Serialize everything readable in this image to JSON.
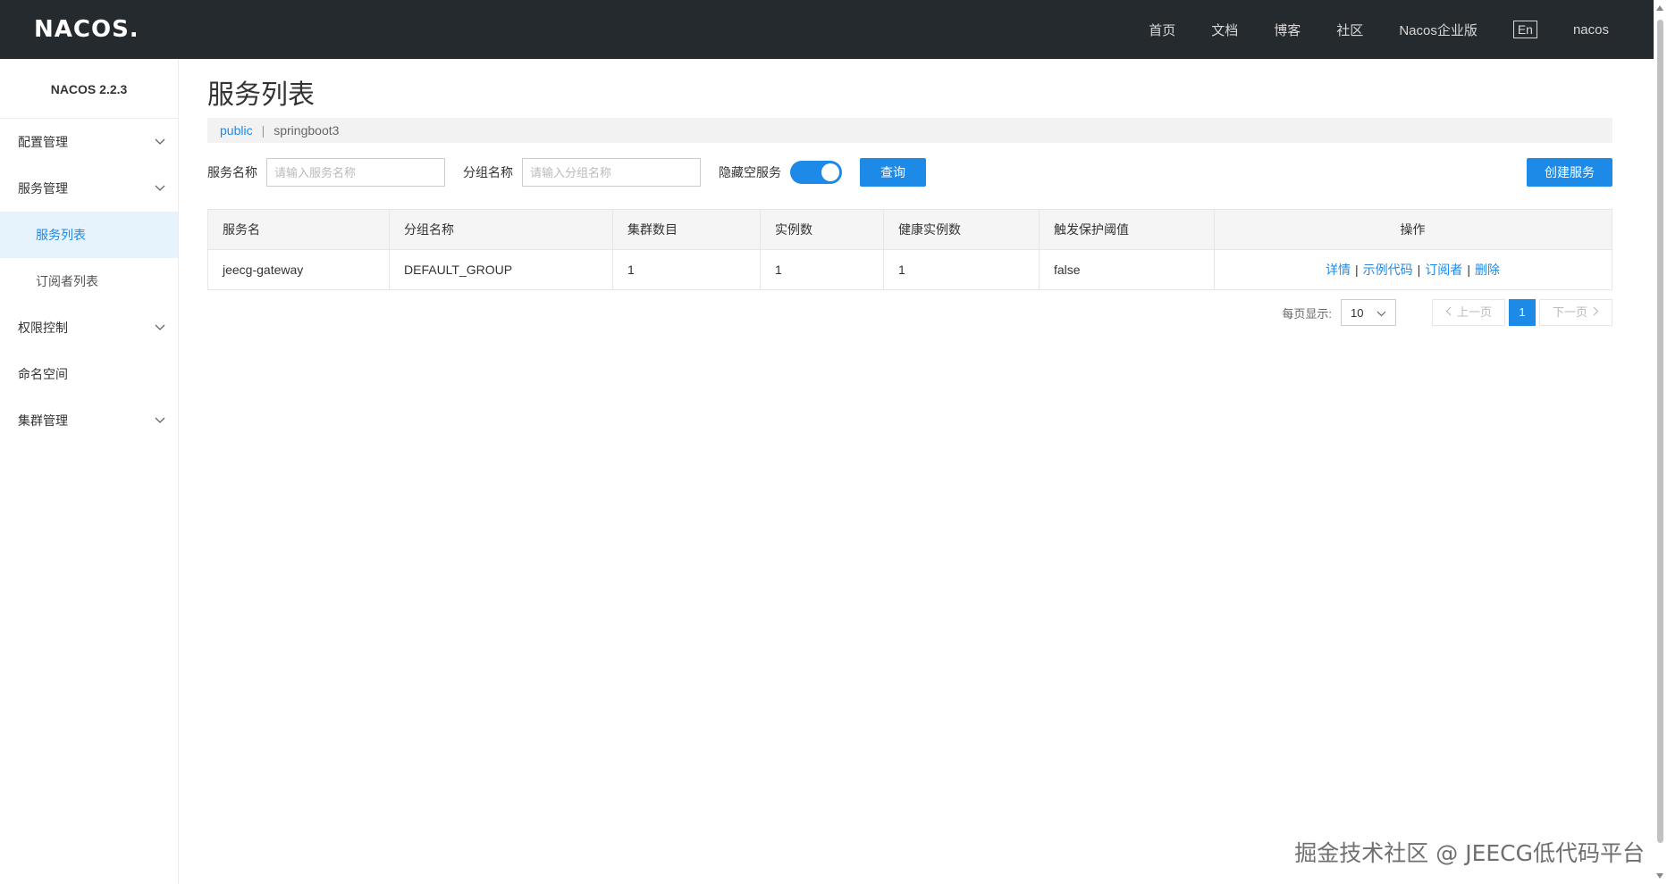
{
  "header": {
    "logo": "NACOS.",
    "nav": [
      "首页",
      "文档",
      "博客",
      "社区",
      "Nacos企业版"
    ],
    "lang": "En",
    "user": "nacos"
  },
  "sidebar": {
    "version": "NACOS 2.2.3",
    "items": [
      {
        "label": "配置管理",
        "type": "group"
      },
      {
        "label": "服务管理",
        "type": "group"
      },
      {
        "label": "服务列表",
        "type": "sub",
        "active": true
      },
      {
        "label": "订阅者列表",
        "type": "sub"
      },
      {
        "label": "权限控制",
        "type": "group"
      },
      {
        "label": "命名空间",
        "type": "item"
      },
      {
        "label": "集群管理",
        "type": "group"
      }
    ]
  },
  "main": {
    "title": "服务列表",
    "breadcrumb": {
      "namespace": "public",
      "separator": "|",
      "current": "springboot3"
    },
    "filters": {
      "service_label": "服务名称",
      "service_placeholder": "请输入服务名称",
      "group_label": "分组名称",
      "group_placeholder": "请输入分组名称",
      "hide_empty_label": "隐藏空服务",
      "hide_empty_on": true,
      "query_button": "查询",
      "create_button": "创建服务"
    },
    "table": {
      "headers": [
        "服务名",
        "分组名称",
        "集群数目",
        "实例数",
        "健康实例数",
        "触发保护阈值",
        "操作"
      ],
      "rows": [
        [
          "jeecg-gateway",
          "DEFAULT_GROUP",
          "1",
          "1",
          "1",
          "false"
        ]
      ],
      "ops": [
        "详情",
        "示例代码",
        "订阅者",
        "删除"
      ]
    },
    "pagination": {
      "page_size_label": "每页显示:",
      "page_size": "10",
      "prev": "上一页",
      "current": "1",
      "next": "下一页"
    }
  },
  "watermark": "掘金技术社区 @ JEECG低代码平台",
  "colors": {
    "primary": "#1e8ae8",
    "topbar": "#252a2f"
  }
}
